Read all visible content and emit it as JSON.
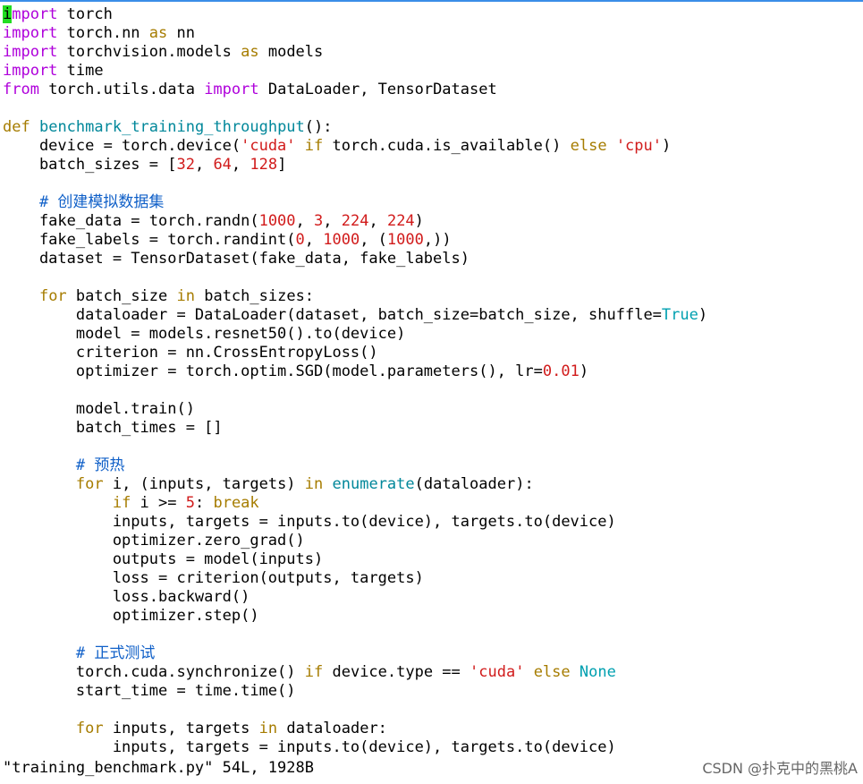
{
  "editor": {
    "lines": [
      [
        {
          "t": "i",
          "c": "cursor"
        },
        {
          "t": "mport",
          "c": "kw"
        },
        {
          "t": " torch",
          "c": ""
        }
      ],
      [
        {
          "t": "import",
          "c": "kw"
        },
        {
          "t": " torch.nn ",
          "c": ""
        },
        {
          "t": "as",
          "c": "ctl"
        },
        {
          "t": " nn",
          "c": ""
        }
      ],
      [
        {
          "t": "import",
          "c": "kw"
        },
        {
          "t": " torchvision.models ",
          "c": ""
        },
        {
          "t": "as",
          "c": "ctl"
        },
        {
          "t": " models",
          "c": ""
        }
      ],
      [
        {
          "t": "import",
          "c": "kw"
        },
        {
          "t": " time",
          "c": ""
        }
      ],
      [
        {
          "t": "from",
          "c": "kw"
        },
        {
          "t": " torch.utils.data ",
          "c": ""
        },
        {
          "t": "import",
          "c": "kw"
        },
        {
          "t": " DataLoader, TensorDataset",
          "c": ""
        }
      ],
      [],
      [
        {
          "t": "def",
          "c": "ctl"
        },
        {
          "t": " ",
          "c": ""
        },
        {
          "t": "benchmark_training_throughput",
          "c": "fn"
        },
        {
          "t": "():",
          "c": ""
        }
      ],
      [
        {
          "t": "    device = torch.device(",
          "c": ""
        },
        {
          "t": "'cuda'",
          "c": "str"
        },
        {
          "t": " ",
          "c": ""
        },
        {
          "t": "if",
          "c": "ctl"
        },
        {
          "t": " torch.cuda.is_available() ",
          "c": ""
        },
        {
          "t": "else",
          "c": "ctl"
        },
        {
          "t": " ",
          "c": ""
        },
        {
          "t": "'cpu'",
          "c": "str"
        },
        {
          "t": ")",
          "c": ""
        }
      ],
      [
        {
          "t": "    batch_sizes = [",
          "c": ""
        },
        {
          "t": "32",
          "c": "num"
        },
        {
          "t": ", ",
          "c": ""
        },
        {
          "t": "64",
          "c": "num"
        },
        {
          "t": ", ",
          "c": ""
        },
        {
          "t": "128",
          "c": "num"
        },
        {
          "t": "]",
          "c": ""
        }
      ],
      [],
      [
        {
          "t": "    # 创建模拟数据集",
          "c": "cmt"
        }
      ],
      [
        {
          "t": "    fake_data = torch.randn(",
          "c": ""
        },
        {
          "t": "1000",
          "c": "num"
        },
        {
          "t": ", ",
          "c": ""
        },
        {
          "t": "3",
          "c": "num"
        },
        {
          "t": ", ",
          "c": ""
        },
        {
          "t": "224",
          "c": "num"
        },
        {
          "t": ", ",
          "c": ""
        },
        {
          "t": "224",
          "c": "num"
        },
        {
          "t": ")",
          "c": ""
        }
      ],
      [
        {
          "t": "    fake_labels = torch.randint(",
          "c": ""
        },
        {
          "t": "0",
          "c": "num"
        },
        {
          "t": ", ",
          "c": ""
        },
        {
          "t": "1000",
          "c": "num"
        },
        {
          "t": ", (",
          "c": ""
        },
        {
          "t": "1000",
          "c": "num"
        },
        {
          "t": ",))",
          "c": ""
        }
      ],
      [
        {
          "t": "    dataset = TensorDataset(fake_data, fake_labels)",
          "c": ""
        }
      ],
      [],
      [
        {
          "t": "    ",
          "c": ""
        },
        {
          "t": "for",
          "c": "ctl"
        },
        {
          "t": " batch_size ",
          "c": ""
        },
        {
          "t": "in",
          "c": "ctl"
        },
        {
          "t": " batch_sizes:",
          "c": ""
        }
      ],
      [
        {
          "t": "        dataloader = DataLoader(dataset, batch_size=batch_size, shuffle=",
          "c": ""
        },
        {
          "t": "True",
          "c": "bi"
        },
        {
          "t": ")",
          "c": ""
        }
      ],
      [
        {
          "t": "        model = models.resnet50().to(device)",
          "c": ""
        }
      ],
      [
        {
          "t": "        criterion = nn.CrossEntropyLoss()",
          "c": ""
        }
      ],
      [
        {
          "t": "        optimizer = torch.optim.SGD(model.parameters(), lr=",
          "c": ""
        },
        {
          "t": "0.01",
          "c": "num"
        },
        {
          "t": ")",
          "c": ""
        }
      ],
      [],
      [
        {
          "t": "        model.train()",
          "c": ""
        }
      ],
      [
        {
          "t": "        batch_times = []",
          "c": ""
        }
      ],
      [],
      [
        {
          "t": "        # 预热",
          "c": "cmt"
        }
      ],
      [
        {
          "t": "        ",
          "c": ""
        },
        {
          "t": "for",
          "c": "ctl"
        },
        {
          "t": " i, (inputs, targets) ",
          "c": ""
        },
        {
          "t": "in",
          "c": "ctl"
        },
        {
          "t": " ",
          "c": ""
        },
        {
          "t": "enumerate",
          "c": "fn"
        },
        {
          "t": "(dataloader):",
          "c": ""
        }
      ],
      [
        {
          "t": "            ",
          "c": ""
        },
        {
          "t": "if",
          "c": "ctl"
        },
        {
          "t": " i >= ",
          "c": ""
        },
        {
          "t": "5",
          "c": "num"
        },
        {
          "t": ": ",
          "c": ""
        },
        {
          "t": "break",
          "c": "ctl"
        }
      ],
      [
        {
          "t": "            inputs, targets = inputs.to(device), targets.to(device)",
          "c": ""
        }
      ],
      [
        {
          "t": "            optimizer.zero_grad()",
          "c": ""
        }
      ],
      [
        {
          "t": "            outputs = model(inputs)",
          "c": ""
        }
      ],
      [
        {
          "t": "            loss = criterion(outputs, targets)",
          "c": ""
        }
      ],
      [
        {
          "t": "            loss.backward()",
          "c": ""
        }
      ],
      [
        {
          "t": "            optimizer.step()",
          "c": ""
        }
      ],
      [],
      [
        {
          "t": "        # 正式测试",
          "c": "cmt"
        }
      ],
      [
        {
          "t": "        torch.cuda.synchronize() ",
          "c": ""
        },
        {
          "t": "if",
          "c": "ctl"
        },
        {
          "t": " device.type == ",
          "c": ""
        },
        {
          "t": "'cuda'",
          "c": "str"
        },
        {
          "t": " ",
          "c": ""
        },
        {
          "t": "else",
          "c": "ctl"
        },
        {
          "t": " ",
          "c": ""
        },
        {
          "t": "None",
          "c": "bi"
        }
      ],
      [
        {
          "t": "        start_time = time.time()",
          "c": ""
        }
      ],
      [],
      [
        {
          "t": "        ",
          "c": ""
        },
        {
          "t": "for",
          "c": "ctl"
        },
        {
          "t": " inputs, targets ",
          "c": ""
        },
        {
          "t": "in",
          "c": "ctl"
        },
        {
          "t": " dataloader:",
          "c": ""
        }
      ],
      [
        {
          "t": "            inputs, targets = inputs.to(device), targets.to(device)",
          "c": ""
        }
      ]
    ]
  },
  "statusbar": {
    "text": "\"training_benchmark.py\" 54L, 1928B"
  },
  "watermark": {
    "text": "CSDN @扑克中的黑桃A"
  }
}
